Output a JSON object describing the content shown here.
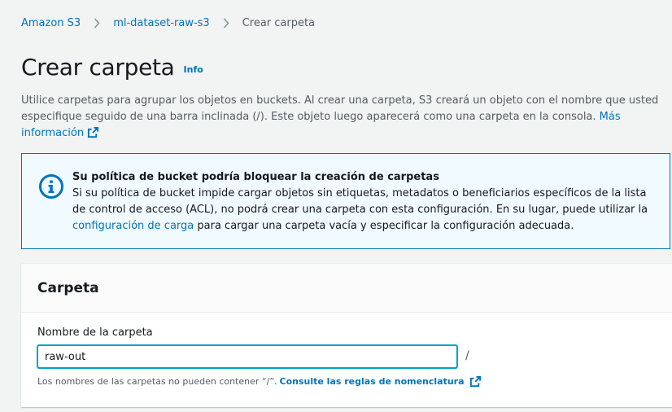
{
  "breadcrumb": {
    "items": [
      "Amazon S3",
      "ml-dataset-raw-s3"
    ],
    "current": "Crear carpeta"
  },
  "header": {
    "title": "Crear carpeta",
    "info": "Info"
  },
  "description": {
    "text": "Utilice carpetas para agrupar los objetos en buckets. Al crear una carpeta, S3 creará un objeto con el nombre que usted especifique seguido de una barra inclinada (/). Este objeto luego aparecerá como una carpeta en la consola.",
    "link": "Más información"
  },
  "alert": {
    "title": "Su política de bucket podría bloquear la creación de carpetas",
    "body_before": "Si su política de bucket impide cargar objetos sin etiquetas, metadatos o beneficiarios específicos de la lista de control de acceso (ACL), no podrá crear una carpeta con esta configuración. En su lugar, puede utilizar la",
    "link": "configuración de carga",
    "body_after": "para cargar una carpeta vacía y especificar la configuración adecuada.",
    "icon": "info-circle-icon",
    "color": "#0073bb"
  },
  "panel": {
    "title": "Carpeta",
    "field_label": "Nombre de la carpeta",
    "field_value": "raw-out",
    "suffix": "/",
    "hint_text": "Los nombres de las carpetas no pueden contener “/”.",
    "hint_link": "Consulte las reglas de nomenclatura"
  },
  "colors": {
    "link": "#0073bb",
    "focus": "#00a1c9",
    "background": "#f2f3f3"
  }
}
